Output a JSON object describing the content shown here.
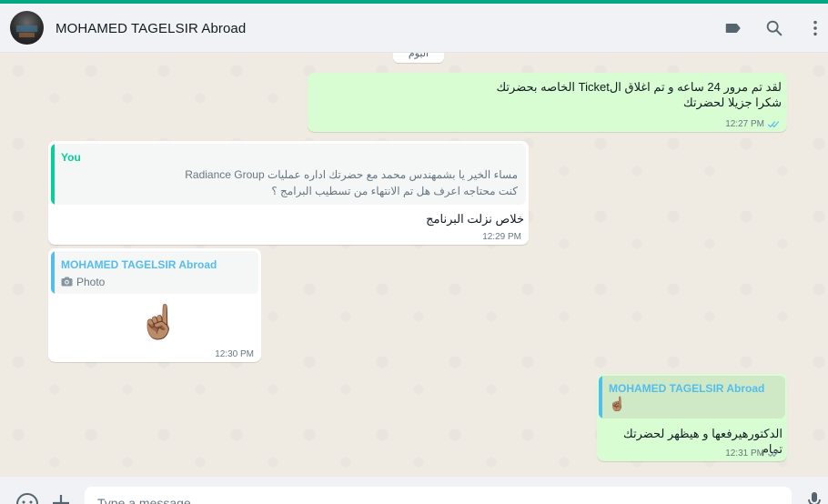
{
  "header": {
    "contact_name": "MOHAMED TAGELSIR Abroad",
    "icons": [
      "label-icon",
      "search-icon",
      "menu-icon"
    ]
  },
  "date_chip": "اليوم",
  "messages": [
    {
      "direction": "outgoing",
      "lines": [
        "لقد تم مرور 24 ساعه و تم اغلاق الTicket الخاصه بحضرتك",
        "شكرا جزيلا لحضرتك"
      ],
      "time": "12:27 PM",
      "status": "read"
    },
    {
      "direction": "incoming",
      "quote": {
        "author": "You",
        "lines": [
          "مساء الخير يا بشمهندس محمد مع حضرتك اداره عمليات Radiance Group",
          "كنت محتاجه اعرف هل تم الانتهاء من تسطيب البرامج ؟"
        ]
      },
      "text": "خلاص نزلت البرنامج",
      "time": "12:29 PM"
    },
    {
      "direction": "incoming",
      "quote": {
        "author": "MOHAMED TAGELSIR Abroad",
        "text": "Photo",
        "icon": "camera-icon"
      },
      "emoji": "☝🏽",
      "time": "12:30 PM"
    },
    {
      "direction": "outgoing",
      "quote": {
        "author": "MOHAMED TAGELSIR Abroad",
        "emoji": "☝🏽"
      },
      "text": "الدكتورهيرفعها و هيظهر لحضرتك تمام",
      "time": "12:31 PM",
      "status": "delivered"
    }
  ],
  "composer": {
    "placeholder": "Type a message",
    "icons": [
      "emoji-icon",
      "attach-icon",
      "microphone-icon"
    ]
  },
  "colors": {
    "accent": "#00a884",
    "outgoing_bubble": "#d9fdd3",
    "incoming_bubble": "#ffffff",
    "you_quote": "#06cf9c",
    "contact_quote": "#53bdeb",
    "read_ticks": "#53bdeb"
  }
}
